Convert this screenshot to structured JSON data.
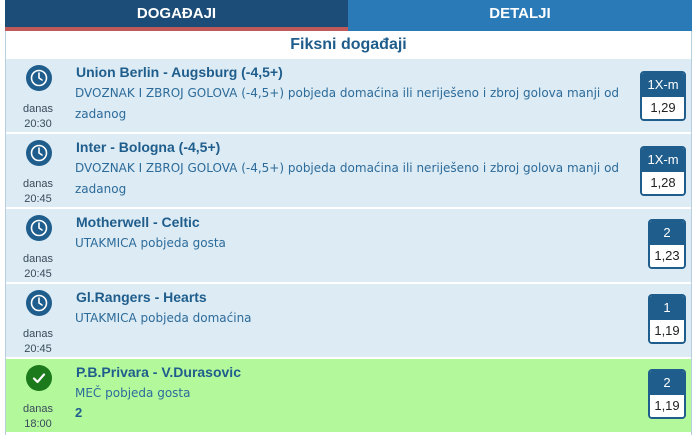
{
  "tabs": {
    "events": "DOGAĐAJI",
    "details": "DETALJI"
  },
  "section_title": "Fiksni događaji",
  "rows": [
    {
      "match": "Union Berlin - Augsburg (-4,5+)",
      "desc": "DVOZNAK I ZBROJ GOLOVA (-4,5+) pobjeda domaćina ili neriješeno i zbroj golova manji od zadanog",
      "day": "danas",
      "time": "20:30",
      "pick": "1X-m",
      "odd": "1,29",
      "status": "clock-icon"
    },
    {
      "match": "Inter - Bologna (-4,5+)",
      "desc": "DVOZNAK I ZBROJ GOLOVA (-4,5+) pobjeda domaćina ili neriješeno i zbroj golova manji od zadanog",
      "day": "danas",
      "time": "20:45",
      "pick": "1X-m",
      "odd": "1,28",
      "status": "clock-icon"
    },
    {
      "match": "Motherwell - Celtic",
      "desc": "UTAKMICA pobjeda gosta",
      "day": "danas",
      "time": "20:45",
      "pick": "2",
      "odd": "1,23",
      "status": "clock-icon"
    },
    {
      "match": "Gl.Rangers - Hearts",
      "desc": "UTAKMICA pobjeda domaćina",
      "day": "danas",
      "time": "20:45",
      "pick": "1",
      "odd": "1,19",
      "status": "clock-icon"
    },
    {
      "match": "P.B.Privara - V.Durasovic",
      "desc": "MEČ pobjeda gosta",
      "score": "2",
      "day": "danas",
      "time": "18:00",
      "pick": "2",
      "odd": "1,19",
      "status": "check-icon"
    }
  ],
  "colors": {
    "header_dark": "#1c4d78",
    "header_light": "#2a7ab8",
    "row_bg": "#dcebf4",
    "won_bg": "#b3f99c",
    "accent": "#c05a5a"
  }
}
